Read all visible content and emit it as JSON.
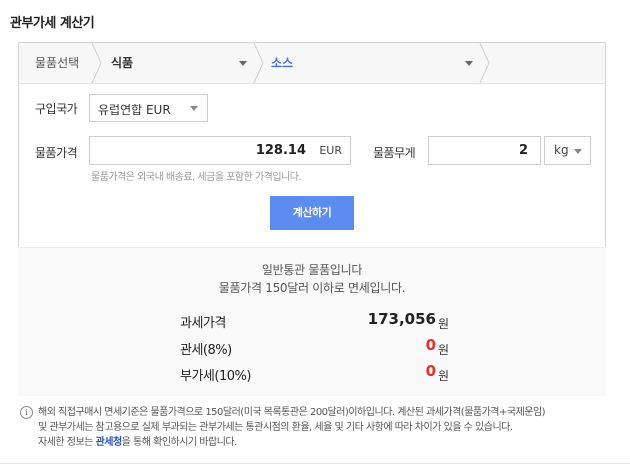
{
  "title": "관부가세 계산기",
  "category": {
    "label": "물품선택",
    "selected": "식품",
    "subselected": "소스"
  },
  "country": {
    "label": "구입국가",
    "value": "유럽연합 EUR"
  },
  "price": {
    "label": "물품가격",
    "value": "128.14",
    "currency": "EUR",
    "hint": "물품가격은 외국내 배송료, 세금을 포함한 가격입니다."
  },
  "weight": {
    "label": "물품무게",
    "value": "2",
    "unit": "kg"
  },
  "calc_button": "계산하기",
  "result": {
    "line1": "일반통관 물품입니다",
    "line2": "물품가격 150달러 이하로 면세입니다.",
    "rows": [
      {
        "label": "과세가격",
        "value": "173,056",
        "unit": "원",
        "color": "#222222"
      },
      {
        "label": "관세(8%)",
        "value": "0",
        "unit": "원",
        "color": "#e8312f"
      },
      {
        "label": "부가세(10%)",
        "value": "0",
        "unit": "원",
        "color": "#e8312f"
      }
    ]
  },
  "notice": {
    "line1": "해외 직접구매시 면세기준은 물품가격으로 150달러(미국 목록통관은 200달러)이하입니다. 계산된 과세가격(물품가격+국제운임)",
    "line2": "및 관부가세는 참고용으로 실제 부과되는 관부가세는 통관시점의 환율, 세율 및 기타 사항에 따라 차이가 있을 수 있습니다.",
    "line3_pre": "자세한 정보는 ",
    "line3_link": "관세청",
    "line3_post": "을 통해 확인하시기 바랍니다."
  }
}
